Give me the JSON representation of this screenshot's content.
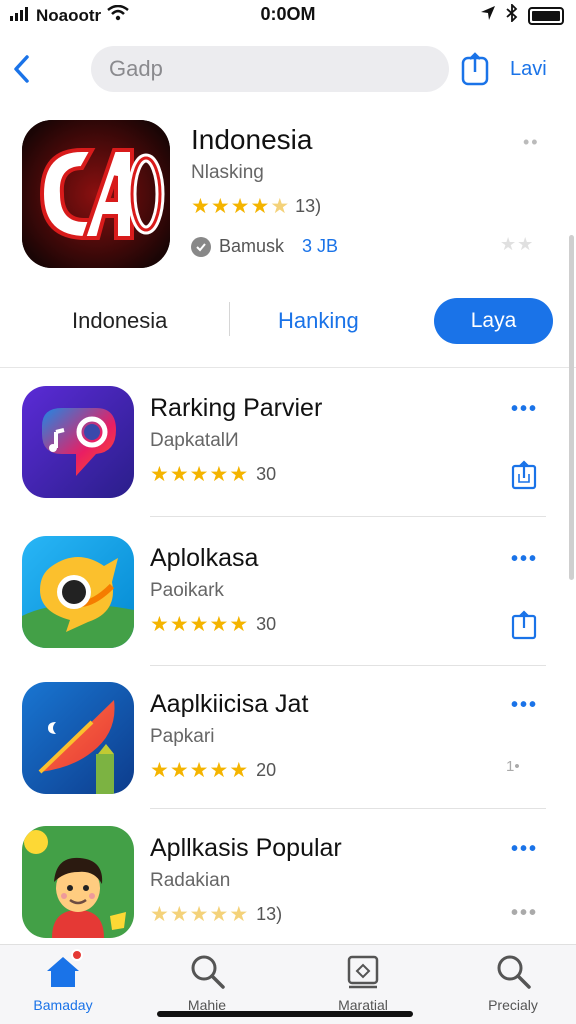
{
  "status_bar": {
    "carrier": "Noaootr",
    "time": "0:0OM"
  },
  "header": {
    "search_placeholder": "Gadp",
    "link_label": "Lavi"
  },
  "featured": {
    "title": "Indonesia",
    "subtitle": "Nlasking",
    "rating_count": "13)",
    "meta_label": "Bamusk",
    "meta_size": "3 JB"
  },
  "tabs": {
    "tab1": "Indonesia",
    "tab2": "Hanking",
    "primary": "Laya"
  },
  "apps": [
    {
      "name": "Rarking Parvier",
      "subtitle": "DapkatalИ",
      "rating_count": "30",
      "more_style": "blue",
      "action": "share"
    },
    {
      "name": "Aplolkasa",
      "subtitle": "Paoikark",
      "rating_count": "30",
      "more_style": "blue",
      "action": "share"
    },
    {
      "name": "Aaplkiicisa  Jat",
      "subtitle": "Papkari",
      "rating_count": "20",
      "more_style": "blue",
      "action": "text",
      "side_text": "1•"
    },
    {
      "name": "Apllkasis Popular",
      "subtitle": "Radakian",
      "rating_count": "13)",
      "more_style": "grey",
      "action": "none"
    }
  ],
  "tabbar": [
    {
      "label": "Bamaday",
      "icon": "home-icon",
      "active": true
    },
    {
      "label": "Mahie",
      "icon": "search-icon",
      "active": false
    },
    {
      "label": "Maratial",
      "icon": "map-icon",
      "active": false
    },
    {
      "label": "Precialy",
      "icon": "search-icon",
      "active": false
    }
  ],
  "colors": {
    "accent": "#1a73e8",
    "star": "#f4b400",
    "badge": "#e53935"
  }
}
